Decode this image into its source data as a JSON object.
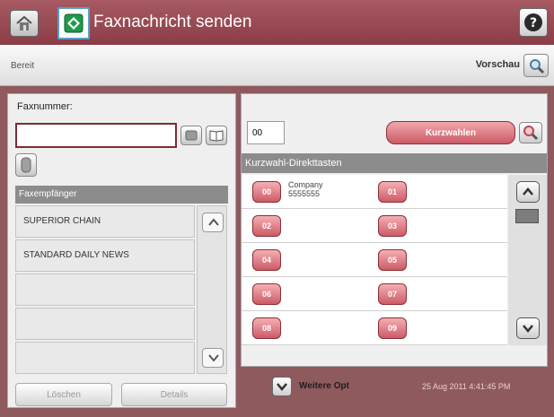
{
  "titlebar": {
    "title": "Faxnachricht senden"
  },
  "statusbar": {
    "status": "Bereit",
    "preview_label": "Vorschau"
  },
  "left_panel": {
    "fax_number_label": "Faxnummer:",
    "fax_number_value": "",
    "recipients_header": "Faxempfänger",
    "recipients": [
      "SUPERIOR CHAIN",
      "STANDARD DAILY NEWS",
      "",
      "",
      ""
    ],
    "delete_label": "Löschen",
    "details_label": "Details"
  },
  "right_panel": {
    "speed_dial_value": "00",
    "speed_dial_button": "Kurzwahlen",
    "keys_header": "Kurzwahl-Direkttasten",
    "keys": [
      {
        "number": "00",
        "name": "Company",
        "detail": "5555555"
      },
      {
        "number": "01",
        "name": "",
        "detail": ""
      },
      {
        "number": "02",
        "name": "",
        "detail": ""
      },
      {
        "number": "03",
        "name": "",
        "detail": ""
      },
      {
        "number": "04",
        "name": "",
        "detail": ""
      },
      {
        "number": "05",
        "name": "",
        "detail": ""
      },
      {
        "number": "06",
        "name": "",
        "detail": ""
      },
      {
        "number": "07",
        "name": "",
        "detail": ""
      },
      {
        "number": "08",
        "name": "",
        "detail": ""
      },
      {
        "number": "09",
        "name": "",
        "detail": ""
      }
    ]
  },
  "bottom": {
    "more_options_label": "Weitere Opt",
    "datetime": "25 Aug 2011 4:41:45 PM"
  },
  "icons": {
    "home": "home-icon",
    "app": "fax-send-icon",
    "help": "help-icon",
    "preview": "magnifier-icon",
    "backspace": "backspace-icon",
    "address_book": "address-book-icon",
    "pause": "pause-icon",
    "more": "chevron-down-icon"
  },
  "colors": {
    "accent": "#8a3d46",
    "key_button": "#cc5a66"
  }
}
